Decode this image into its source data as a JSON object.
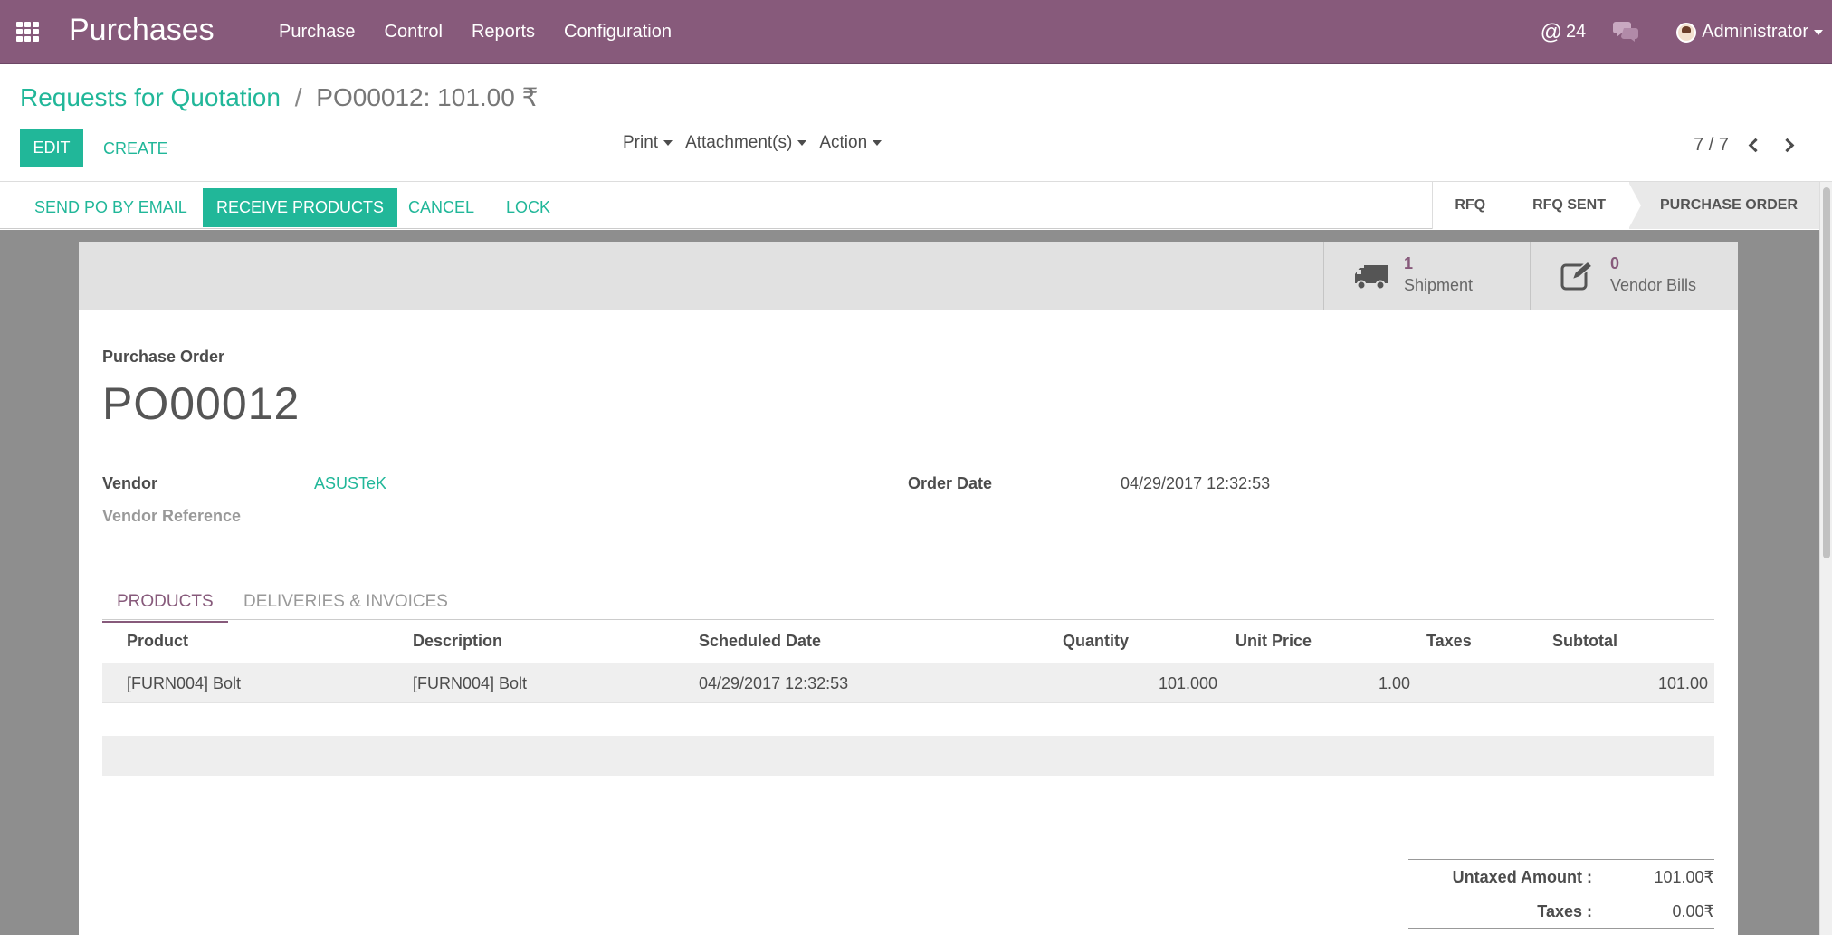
{
  "navbar": {
    "brand": "Purchases",
    "menu": [
      "Purchase",
      "Control",
      "Reports",
      "Configuration"
    ],
    "mentions_count": "24",
    "user": "Administrator",
    "accent": "#875a7b"
  },
  "control_panel": {
    "breadcrumb_parent": "Requests for Quotation",
    "breadcrumb_sep": "/",
    "breadcrumb_current": "PO00012: 101.00 ₹",
    "edit_label": "EDIT",
    "create_label": "CREATE",
    "print_label": "Print",
    "attachments_label": "Attachment(s)",
    "action_label": "Action",
    "pager": "7 / 7"
  },
  "statusbar": {
    "send_po_label": "SEND PO BY EMAIL",
    "receive_label": "RECEIVE PRODUCTS",
    "cancel_label": "CANCEL",
    "lock_label": "LOCK",
    "stages": [
      "RFQ",
      "RFQ SENT",
      "PURCHASE ORDER"
    ],
    "current_stage": "PURCHASE ORDER"
  },
  "smart_buttons": {
    "shipment_count": "1",
    "shipment_label": "Shipment",
    "bills_count": "0",
    "bills_label": "Vendor Bills"
  },
  "form": {
    "doc_type_label": "Purchase Order",
    "name": "PO00012",
    "vendor_label": "Vendor",
    "vendor_value": "ASUSTeK",
    "vendor_ref_label": "Vendor Reference",
    "order_date_label": "Order Date",
    "order_date_value": "04/29/2017 12:32:53"
  },
  "tabs": {
    "products": "PRODUCTS",
    "deliveries": "DELIVERIES & INVOICES"
  },
  "order_lines": {
    "headers": {
      "product": "Product",
      "description": "Description",
      "scheduled_date": "Scheduled Date",
      "quantity": "Quantity",
      "unit_price": "Unit Price",
      "taxes": "Taxes",
      "subtotal": "Subtotal"
    },
    "rows": [
      {
        "product": "[FURN004] Bolt",
        "description": "[FURN004] Bolt",
        "scheduled_date": "04/29/2017 12:32:53",
        "quantity": "101.000",
        "unit_price": "1.00",
        "taxes": "",
        "subtotal": "101.00"
      }
    ]
  },
  "totals": {
    "untaxed_label": "Untaxed Amount :",
    "untaxed_value": "101.00₹",
    "taxes_label": "Taxes :",
    "taxes_value": "0.00₹"
  }
}
